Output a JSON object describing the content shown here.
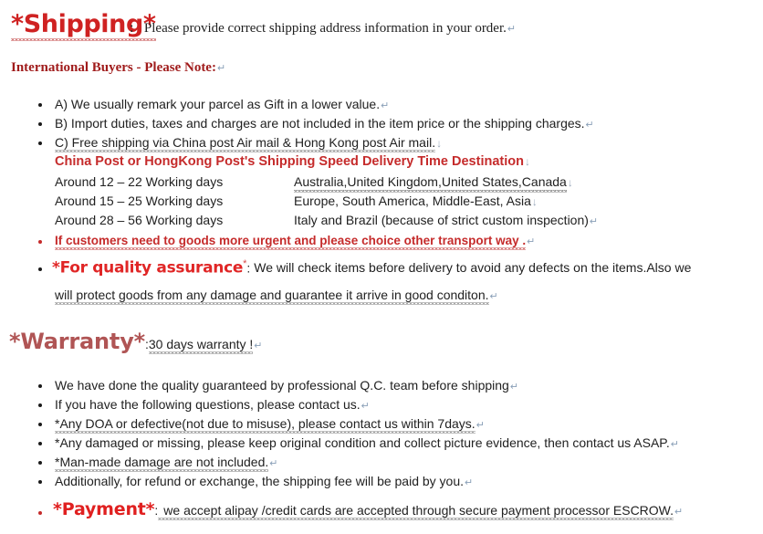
{
  "document": {
    "colors": {
      "shipping_red": "#cf2222",
      "warranty_red": "#b05555",
      "payment_red": "#e02020",
      "heading_dark_red": "#a01c1c",
      "accent_red": "#c52b2b",
      "body_black": "#212121",
      "background": "#ffffff"
    },
    "shipping": {
      "title": "*Shipping*",
      "colon": ":",
      "intro": "Please provide correct shipping address information in your order.",
      "intl_note": "International Buyers - Please Note:",
      "bullets": [
        "A) We usually remark your parcel as Gift in a lower value.",
        "B) Import duties, taxes and charges are not included in the item price or the shipping charges.",
        "C) Free shipping via China post Air mail & Hong Kong post Air mail."
      ],
      "table_heading": "China Post or HongKong Post's Shipping Speed Delivery Time Destination",
      "delivery_table": {
        "columns": [
          "Shipping Speed Delivery Time",
          "Destination"
        ],
        "rows": [
          {
            "time": "Around 12 – 22 Working days",
            "destination": "Australia,United Kingdom,United States,Canada"
          },
          {
            "time": "Around 15 – 25 Working days",
            "destination": "Europe, South America, Middle-East, Asia"
          },
          {
            "time": "Around 28 – 56 Working days",
            "destination": "Italy and Brazil (because of strict custom inspection)"
          }
        ]
      },
      "urgent_note": "If customers need to goods more urgent and please choice other transport way .",
      "quality": {
        "title": "*For quality assurance",
        "star": "*",
        "colon": ":",
        "line1": "We will check items before delivery to avoid any defects on the items.Also we",
        "line2": "will protect goods from any damage and guarantee it arrive in good conditon."
      }
    },
    "warranty": {
      "title": "*Warranty*",
      "colon": ":",
      "subtitle": "30 days warranty !",
      "bullets": [
        "We have done the quality guaranteed by professional Q.C. team before shipping",
        "If you have the following questions, please contact us.",
        "*Any DOA or defective(not due to misuse), please contact us within 7days.",
        "*Any damaged or missing, please keep original condition and collect picture evidence, then contact us ASAP.",
        "*Man-made damage are not included.",
        "Additionally, for refund or exchange, the shipping fee will be paid by you."
      ]
    },
    "payment": {
      "title": "*Payment*",
      "colon": ":",
      "text": "we accept alipay /credit cards are accepted through secure payment processor ESCROW."
    },
    "marks": {
      "pilcrow": "↵",
      "arrow_down": "↓"
    }
  }
}
